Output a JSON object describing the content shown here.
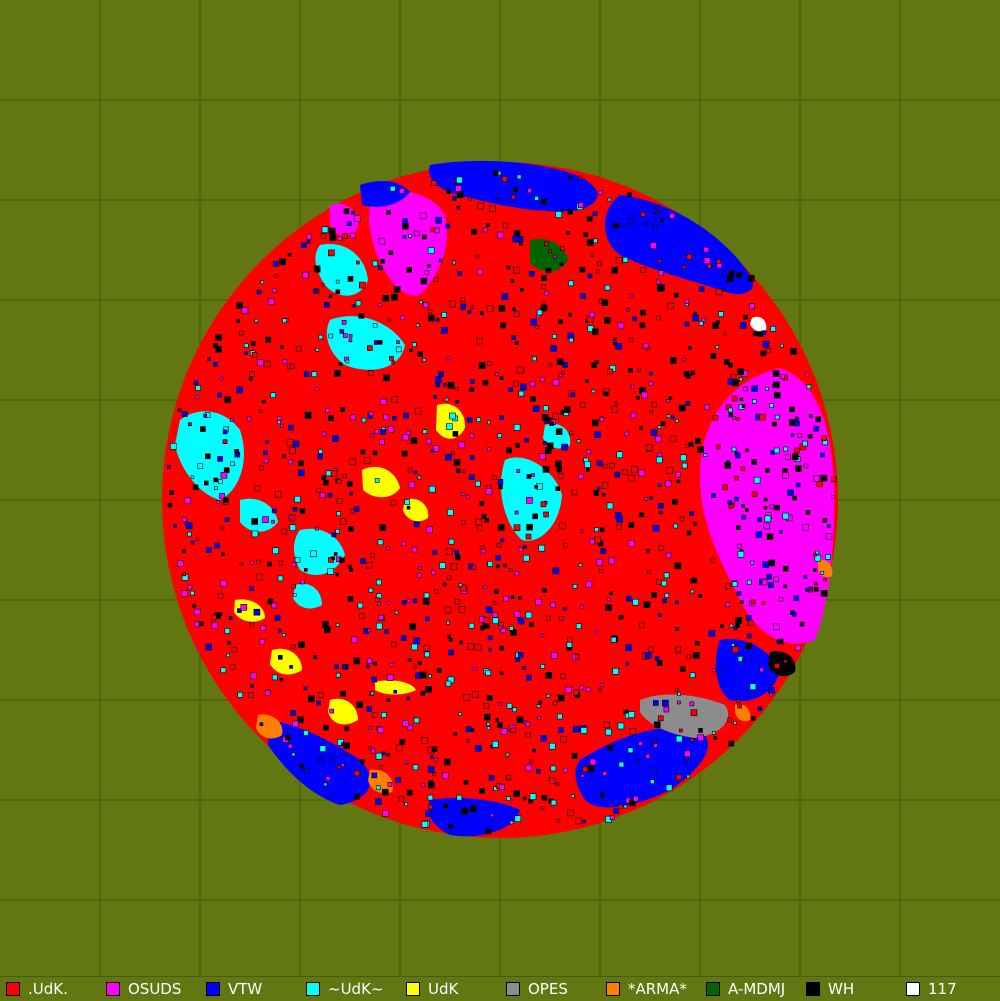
{
  "map": {
    "background_color": "#627611",
    "grid_color": "#3f5a12",
    "grid_columns": 10,
    "grid_rows": 10
  },
  "legend": [
    {
      "name": ".UdK.",
      "color": "#ff0000"
    },
    {
      "name": "OSUDS",
      "color": "#ff00ff"
    },
    {
      "name": "VTW",
      "color": "#0000ff"
    },
    {
      "name": "~UdK~",
      "color": "#00ffff"
    },
    {
      "name": "UdK",
      "color": "#ffff00"
    },
    {
      "name": "OPES",
      "color": "#8c8c8c"
    },
    {
      "name": "*ARMA*",
      "color": "#ff8000"
    },
    {
      "name": "A-MDMJ",
      "color": "#006400"
    },
    {
      "name": "WH",
      "color": "#000000"
    },
    {
      "name": "117",
      "color": "#ffffff"
    }
  ]
}
